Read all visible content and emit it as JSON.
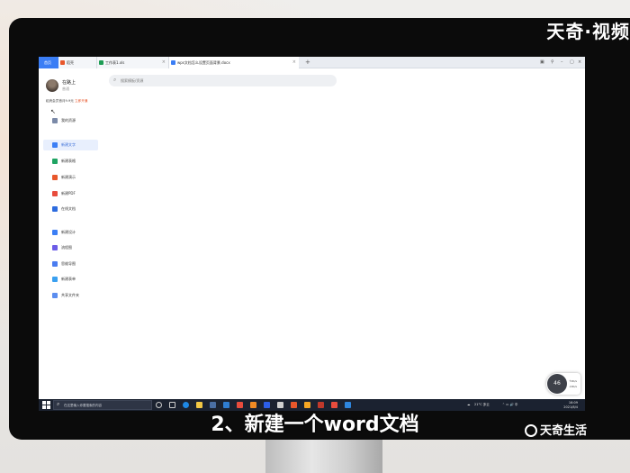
{
  "watermark_top": "天奇·视频",
  "tabs": [
    {
      "label": "首页",
      "color": "#3b7ef5"
    },
    {
      "label": "稻壳",
      "color": "#e8572b"
    },
    {
      "label": "工作表1.xls",
      "color": "#1f9d55"
    },
    {
      "label": "wps文档怎么设置页面背景.docx",
      "color": "#3b7ef5"
    }
  ],
  "tab_add": "+",
  "sidebar": {
    "user_name": "在路上",
    "user_sub": "普通",
    "promo_text": "稻壳会员首月9.9元",
    "promo_link": "立即开通",
    "items": [
      {
        "label": "我的资源",
        "icon": "doc-icon",
        "color": "#7b8aa8"
      },
      {
        "label": "新建文字",
        "icon": "word-icon",
        "color": "#3b7ef5"
      },
      {
        "label": "新建表格",
        "icon": "sheet-icon",
        "color": "#1fa463"
      },
      {
        "label": "新建演示",
        "icon": "slides-icon",
        "color": "#e8572b"
      },
      {
        "label": "新建PDF",
        "icon": "pdf-icon",
        "color": "#e84c3d"
      },
      {
        "label": "在线文档",
        "icon": "cloud-doc-icon",
        "color": "#2d6cdf"
      },
      {
        "label": "新建设计",
        "icon": "design-icon",
        "color": "#3b7ef5"
      },
      {
        "label": "流程图",
        "icon": "flowchart-icon",
        "color": "#6c5ce7"
      },
      {
        "label": "思维导图",
        "icon": "mindmap-icon",
        "color": "#4a7cf0"
      },
      {
        "label": "新建表单",
        "icon": "form-icon",
        "color": "#3aa0f0"
      },
      {
        "label": "共享文件夹",
        "icon": "folder-icon",
        "color": "#5b8def"
      }
    ]
  },
  "search": {
    "placeholder": "搜索模板/资源"
  },
  "temp_widget": {
    "value": "46",
    "line1": "↑0K/s",
    "line2": "↓0K/s"
  },
  "taskbar": {
    "search_placeholder": "在这里输入你要搜索的内容",
    "weather": "21°C 多云",
    "time": "16:09",
    "date": "2021/8/4"
  },
  "subtitle": "2、新建一个word文档",
  "brand": "天奇生活"
}
